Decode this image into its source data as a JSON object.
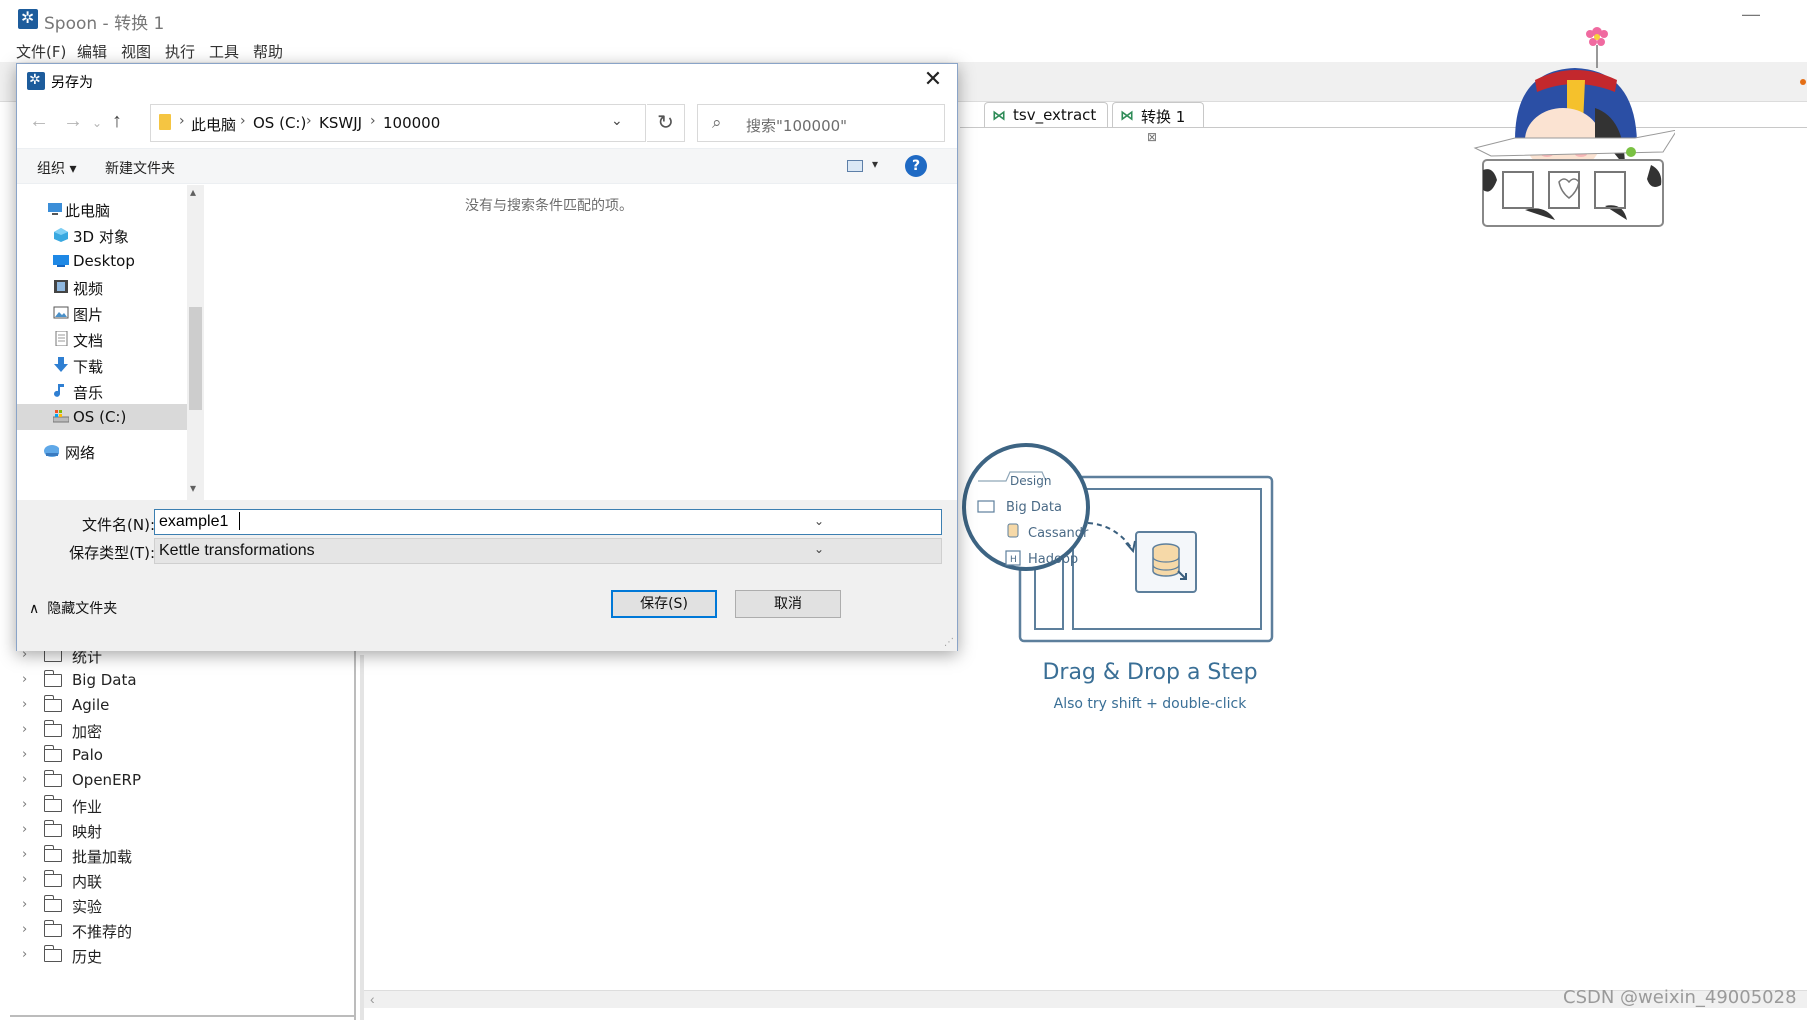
{
  "window": {
    "title": "Spoon - 转换 1",
    "minimize_symbol": "—"
  },
  "menu": [
    "文件(F)",
    "编辑",
    "视图",
    "执行",
    "工具",
    "帮助"
  ],
  "tabs": [
    {
      "label": "tsv_extract",
      "icon": "transformation-icon"
    },
    {
      "label": "转换 1",
      "icon": "transformation-icon",
      "close": "⊠"
    }
  ],
  "design_tree": {
    "items": [
      "统计",
      "Big Data",
      "Agile",
      "加密",
      "Palo",
      "OpenERP",
      "作业",
      "映射",
      "批量加载",
      "内联",
      "实验",
      "不推荐的",
      "历史"
    ]
  },
  "canvas": {
    "illustration": {
      "tab_label": "Design",
      "folder_label": "Big Data",
      "item1": "Cassandr",
      "item2": "Hadoop"
    },
    "drag_title": "Drag & Drop a Step",
    "drag_subtitle": "Also try shift + double-click"
  },
  "watermark": "CSDN @weixin_49005028",
  "dialog": {
    "title": "另存为",
    "close_symbol": "✕",
    "breadcrumb": [
      "此电脑",
      "OS (C:)",
      "KSWJJ",
      "100000"
    ],
    "search_placeholder": "搜索\"100000\"",
    "organize_label": "组织 ▾",
    "new_folder_label": "新建文件夹",
    "help_symbol": "?",
    "nav_items": [
      {
        "label": "此电脑",
        "icon": "this-pc-icon"
      },
      {
        "label": "3D 对象",
        "icon": "3d-objects-icon"
      },
      {
        "label": "Desktop",
        "icon": "desktop-icon"
      },
      {
        "label": "视频",
        "icon": "videos-icon"
      },
      {
        "label": "图片",
        "icon": "pictures-icon"
      },
      {
        "label": "文档",
        "icon": "documents-icon"
      },
      {
        "label": "下载",
        "icon": "downloads-icon"
      },
      {
        "label": "音乐",
        "icon": "music-icon"
      },
      {
        "label": "OS (C:)",
        "icon": "drive-icon",
        "selected": true
      },
      {
        "label": "网络",
        "icon": "network-icon"
      }
    ],
    "empty_message": "没有与搜索条件匹配的项。",
    "filename_label": "文件名(N):",
    "filename_value": "example1",
    "filetype_label": "保存类型(T):",
    "filetype_value": "Kettle transformations",
    "hide_folders_label": "隐藏文件夹",
    "save_button": "保存(S)",
    "cancel_button": "取消"
  },
  "colors": {
    "accent": "#0078d7",
    "brand_blue": "#1d5c9c",
    "canvas_text": "#3a6f96"
  }
}
